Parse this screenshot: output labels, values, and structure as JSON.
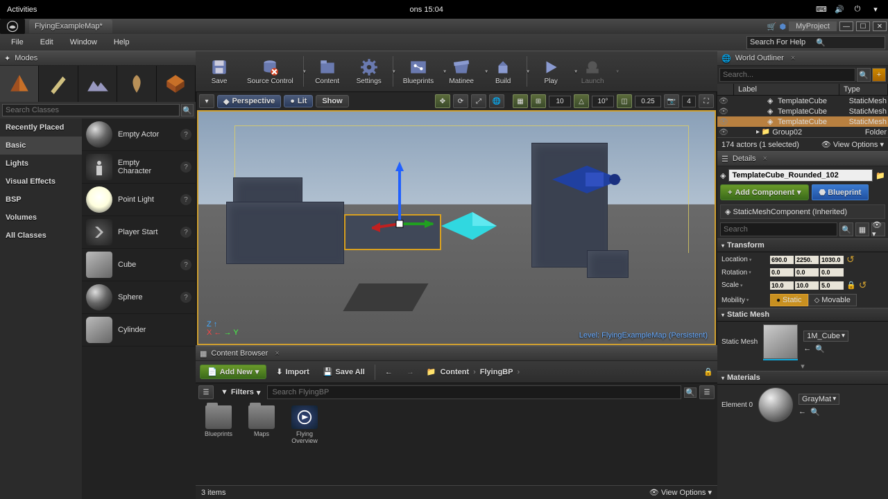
{
  "os": {
    "activities": "Activities",
    "clock": "ons 15:04"
  },
  "doc_tab": "FlyingExampleMap*",
  "project_name": "MyProject",
  "menu": [
    "File",
    "Edit",
    "Window",
    "Help"
  ],
  "search_help_placeholder": "Search For Help",
  "modes": {
    "title": "Modes",
    "search_placeholder": "Search Classes",
    "categories": [
      "Recently Placed",
      "Basic",
      "Lights",
      "Visual Effects",
      "BSP",
      "Volumes",
      "All Classes"
    ],
    "active_category": "Basic",
    "items": [
      {
        "label": "Empty Actor"
      },
      {
        "label": "Empty Character"
      },
      {
        "label": "Point Light"
      },
      {
        "label": "Player Start"
      },
      {
        "label": "Cube"
      },
      {
        "label": "Sphere"
      },
      {
        "label": "Cylinder"
      }
    ]
  },
  "toolbar": {
    "save": "Save",
    "source_control": "Source Control",
    "content": "Content",
    "settings": "Settings",
    "blueprints": "Blueprints",
    "matinee": "Matinee",
    "build": "Build",
    "play": "Play",
    "launch": "Launch"
  },
  "viewport": {
    "perspective": "Perspective",
    "lit": "Lit",
    "show": "Show",
    "grid_snap": "10",
    "angle_snap": "10°",
    "scale_snap": "0.25",
    "cam_speed": "4",
    "level_label": "Level:  FlyingExampleMap (Persistent)"
  },
  "outliner": {
    "title": "World Outliner",
    "search_placeholder": "Search...",
    "col_label": "Label",
    "col_type": "Type",
    "rows": [
      {
        "label": "TemplateCube",
        "type": "StaticMesh",
        "sel": false
      },
      {
        "label": "TemplateCube",
        "type": "StaticMesh",
        "sel": false
      },
      {
        "label": "TemplateCube",
        "type": "StaticMesh",
        "sel": true
      },
      {
        "label": "Group02",
        "type": "Folder",
        "sel": false
      }
    ],
    "status": "174 actors (1 selected)",
    "view_options": "View Options"
  },
  "details": {
    "title": "Details",
    "actor_name": "TemplateCube_Rounded_102",
    "add_component": "Add Component",
    "blueprint_btn": "Blueprint",
    "component": "StaticMeshComponent (Inherited)",
    "search_placeholder": "Search",
    "transform": {
      "header": "Transform",
      "location": {
        "label": "Location",
        "x": "690.0",
        "y": "2250.",
        "z": "1030.0"
      },
      "rotation": {
        "label": "Rotation",
        "x": "0.0",
        "y": "0.0",
        "z": "0.0"
      },
      "scale": {
        "label": "Scale",
        "x": "10.0",
        "y": "10.0",
        "z": "5.0"
      },
      "mobility": {
        "label": "Mobility",
        "static": "Static",
        "movable": "Movable"
      }
    },
    "static_mesh": {
      "header": "Static Mesh",
      "label": "Static Mesh",
      "asset": "1M_Cube"
    },
    "materials": {
      "header": "Materials",
      "slot": "Element 0",
      "asset": "GrayMat"
    }
  },
  "content_browser": {
    "title": "Content Browser",
    "add_new": "Add New",
    "import": "Import",
    "save_all": "Save All",
    "path": [
      "Content",
      "FlyingBP"
    ],
    "filters": "Filters",
    "search_placeholder": "Search FlyingBP",
    "assets": [
      {
        "type": "folder",
        "label": "Blueprints"
      },
      {
        "type": "folder",
        "label": "Maps"
      },
      {
        "type": "level",
        "label": "Flying Overview"
      }
    ],
    "status": "3 items",
    "view_options": "View Options"
  }
}
